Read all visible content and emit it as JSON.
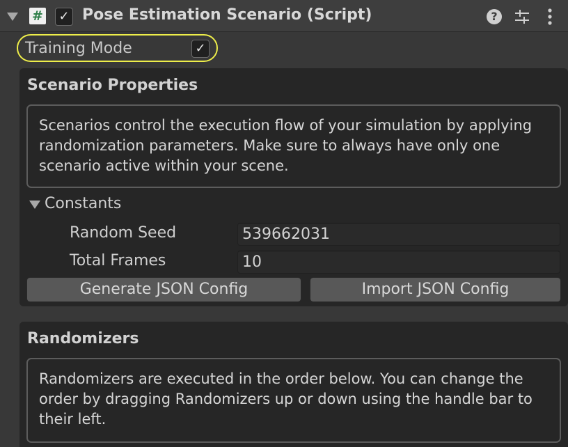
{
  "component": {
    "script_glyph": "#",
    "enabled_check": "✓",
    "title": "Pose Estimation Scenario (Script)",
    "icons": [
      "help-icon",
      "preset-icon",
      "context-menu-icon"
    ]
  },
  "training_mode": {
    "label": "Training Mode",
    "checked": true,
    "check_glyph": "✓",
    "highlight_color": "#eeee4a"
  },
  "scenario_properties": {
    "title": "Scenario Properties",
    "help_text": "Scenarios control the execution flow of your simulation by applying randomization parameters. Make sure to always have only one scenario active within your scene.",
    "constants": {
      "label": "Constants",
      "fields": [
        {
          "label": "Random Seed",
          "value": "539662031"
        },
        {
          "label": "Total Frames",
          "value": "10"
        }
      ]
    },
    "buttons": {
      "generate": "Generate JSON Config",
      "import": "Import JSON Config"
    }
  },
  "randomizers": {
    "title": "Randomizers",
    "help_text": "Randomizers are executed in the order below. You can change the order by dragging Randomizers up or down using the handle bar to their left."
  }
}
